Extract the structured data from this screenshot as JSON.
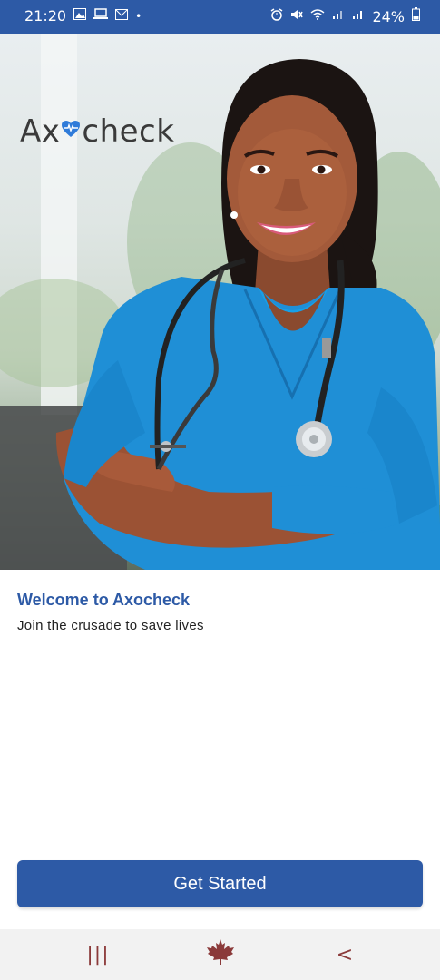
{
  "status_bar": {
    "time": "21:20",
    "battery": "24%",
    "left_icons": [
      "gallery-icon",
      "laptop-icon",
      "mail-icon",
      "dot-icon"
    ],
    "right_icons": [
      "alarm-icon",
      "mute-icon",
      "wifi-icon",
      "signal-icon",
      "signal-icon",
      "battery-icon"
    ]
  },
  "hero": {
    "logo_text_left": "Ax",
    "logo_text_right": "check"
  },
  "welcome": {
    "title": "Welcome to Axocheck",
    "subtitle": "Join the crusade to save lives"
  },
  "cta": {
    "label": "Get Started"
  },
  "nav": {
    "recent": "|||",
    "home": "maple-leaf-icon",
    "back": "<"
  },
  "colors": {
    "primary": "#2d5aa6",
    "nav_icon": "#8b3a3a"
  }
}
